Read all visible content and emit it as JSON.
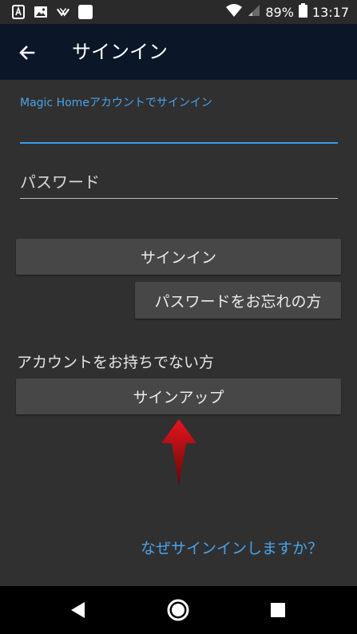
{
  "status_bar": {
    "battery": "89%",
    "time": "13:17",
    "icons_left": [
      "notification-a-icon",
      "image-icon",
      "app-logo-icon",
      "blank-square-icon"
    ],
    "icons_right": [
      "wifi-icon",
      "signal-icon",
      "battery-icon"
    ]
  },
  "app_bar": {
    "title": "サインイン",
    "back_icon": "back-arrow-icon"
  },
  "form": {
    "email_label": "Magic Homeアカウントでサインイン",
    "email_value": "",
    "password_placeholder": "パスワード",
    "signin_label": "サインイン",
    "forgot_label": "パスワードをお忘れの方",
    "no_account_text": "アカウントをお持ちでない方",
    "signup_label": "サインアップ",
    "why_link": "なぜサインインしますか？"
  },
  "colors": {
    "background": "#303030",
    "app_bar": "#0b1628",
    "accent": "#3d9ae8",
    "button": "#474747",
    "arrow": "#c4141a"
  },
  "nav_bar": {
    "icons": [
      "back-triangle-icon",
      "home-circle-icon",
      "recents-square-icon"
    ]
  }
}
